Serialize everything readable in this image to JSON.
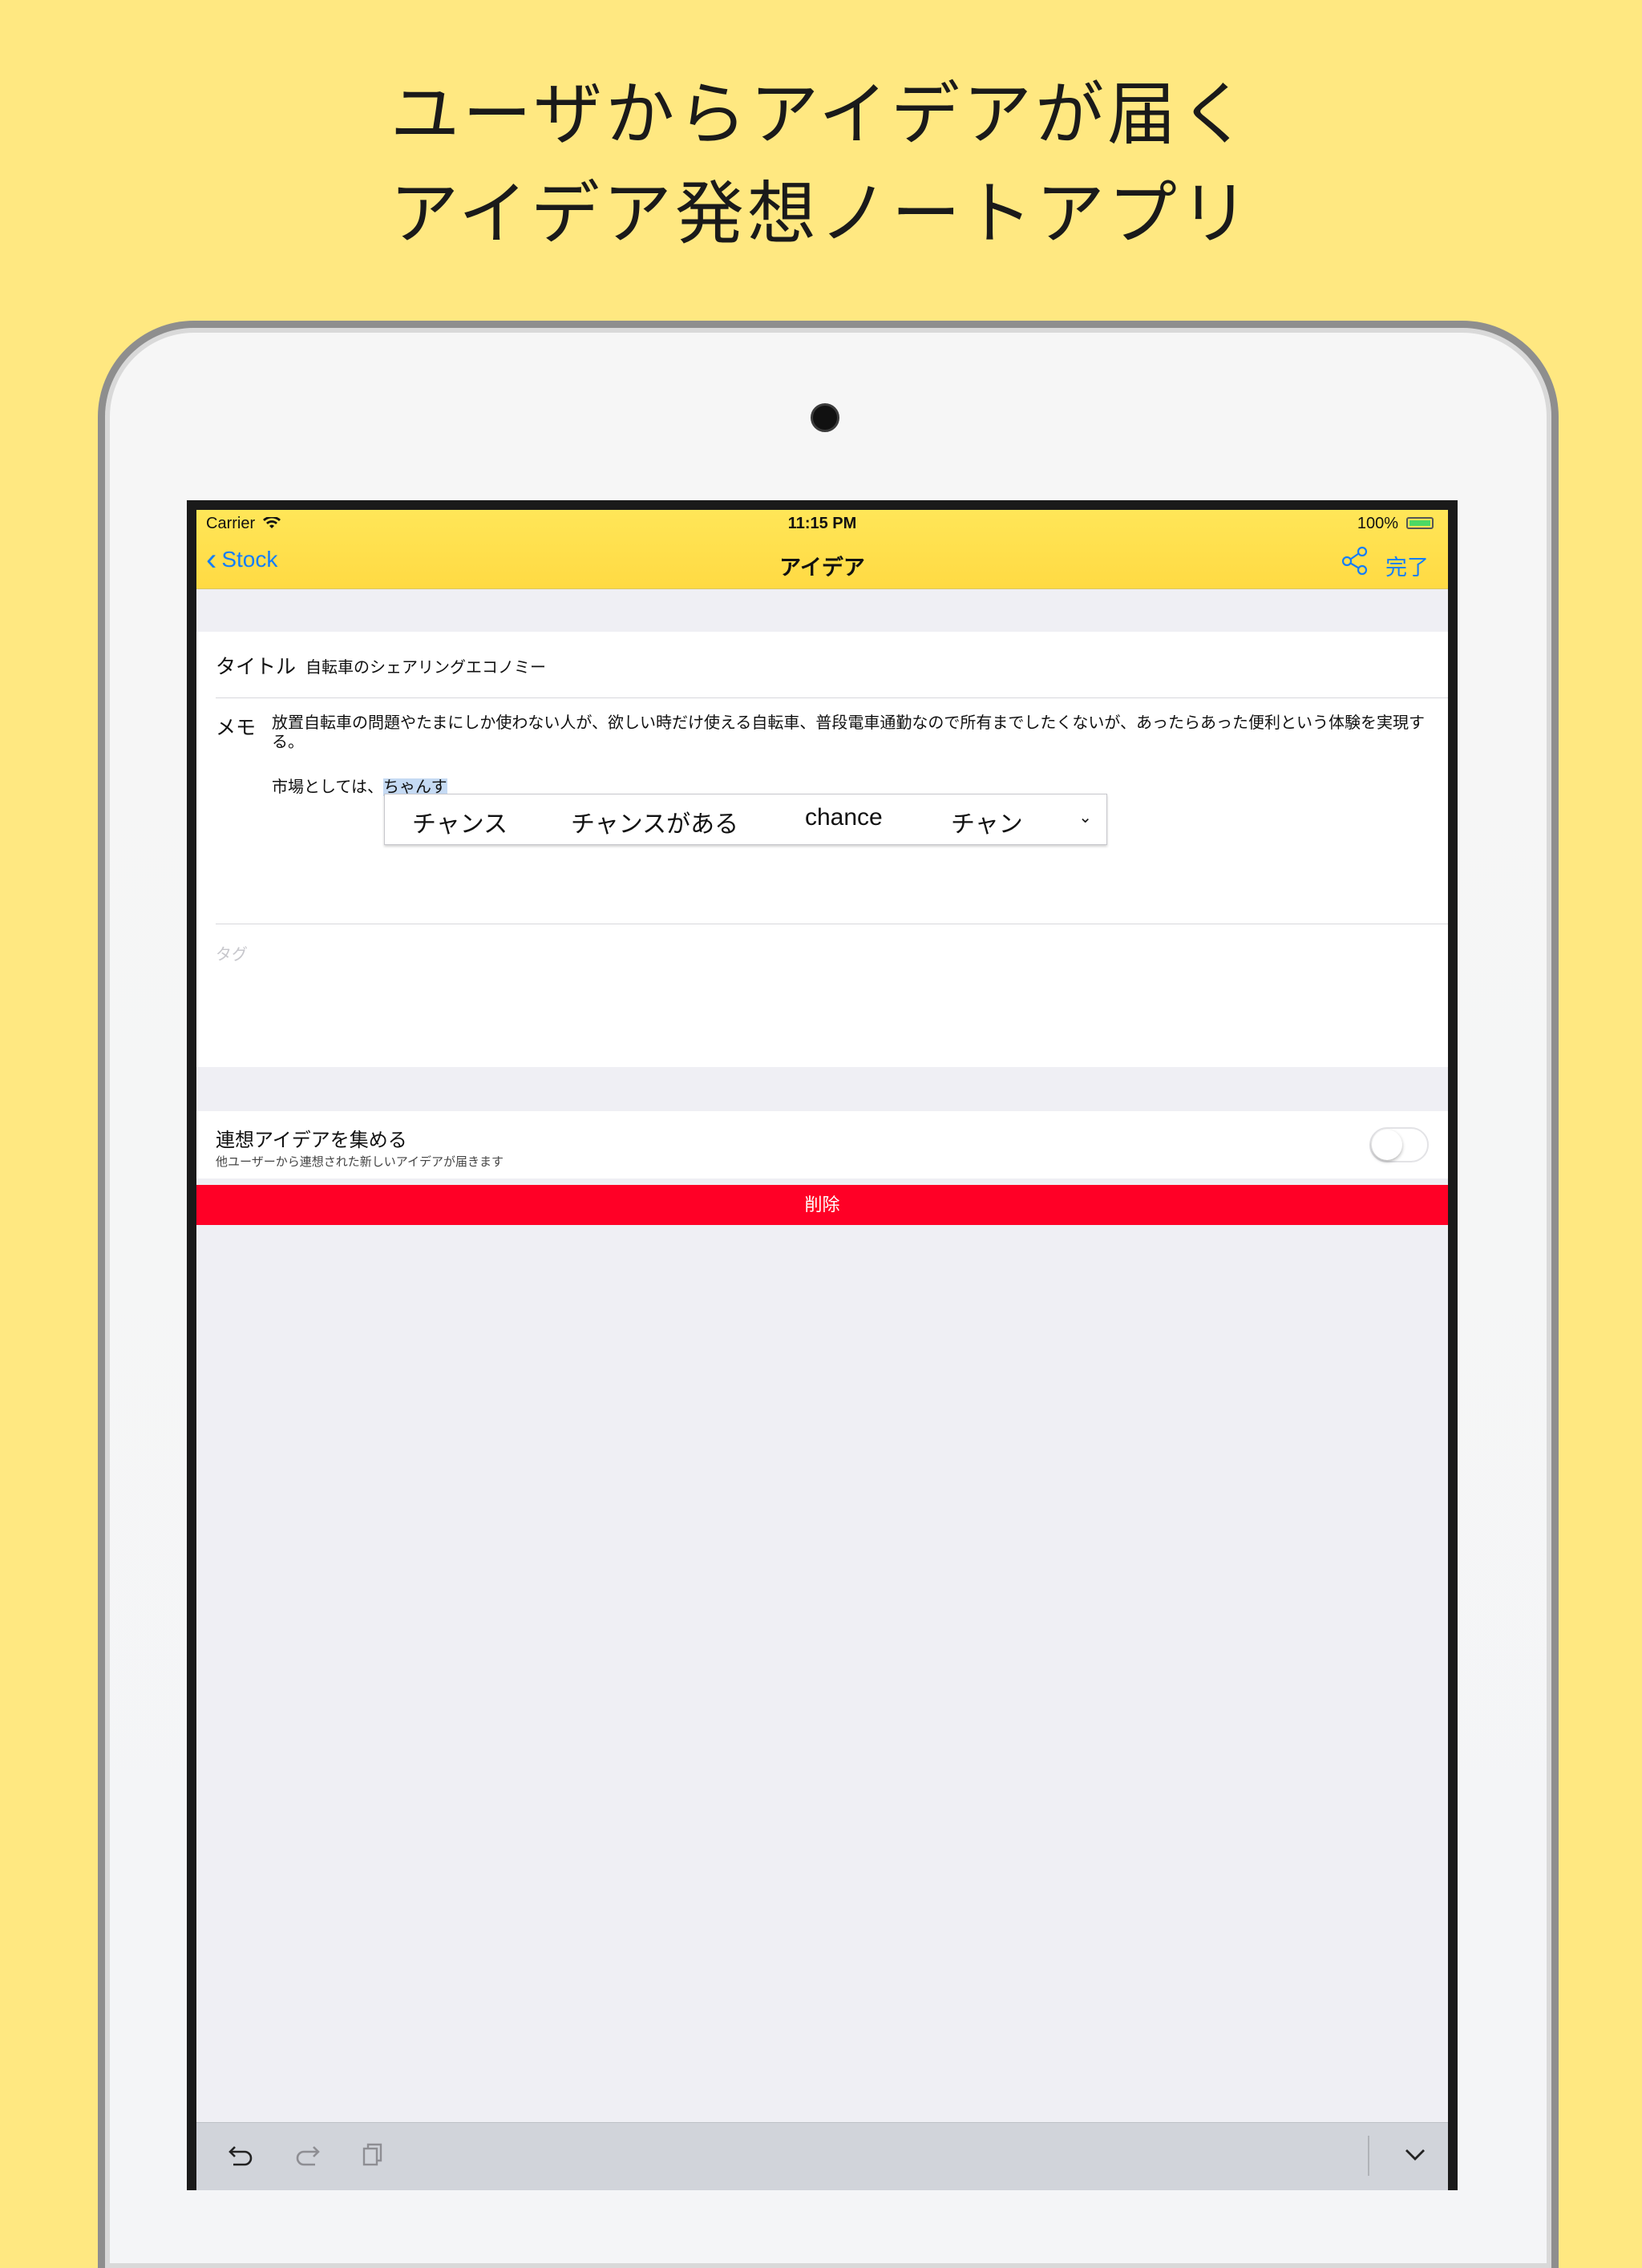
{
  "headline": {
    "line1": "ユーザからアイデアが届く",
    "line2": "アイデア発想ノートアプリ"
  },
  "status_bar": {
    "carrier": "Carrier",
    "time": "11:15 PM",
    "battery": "100%"
  },
  "nav": {
    "back_label": "Stock",
    "title": "アイデア",
    "done_label": "完了",
    "icons": [
      "chevron-left-icon",
      "share-icon"
    ]
  },
  "form": {
    "title_label": "タイトル",
    "title_value": "自転車のシェアリングエコノミー",
    "memo_label": "メモ",
    "memo_text": "放置自転車の問題やたまにしか使わない人が、欲しい時だけ使える自転車、普段電車通勤なので所有までしたくないが、あったらあった便利という体験を実現する。",
    "memo_line2_prefix": "市場としては、",
    "memo_line2_marked": "ちゃんす",
    "tag_placeholder": "タグ"
  },
  "ime_candidates": {
    "items": [
      "チャンス",
      "チャンスがある",
      "chance",
      "チャン"
    ],
    "more": "⌄"
  },
  "collect": {
    "title": "連想アイデアを集める",
    "subtitle": "他ユーザーから連想された新しいアイデアが届きます",
    "enabled": false
  },
  "delete_label": "削除",
  "keyboard_bar": {
    "icons": [
      "undo-icon",
      "redo-icon",
      "paste-icon",
      "dismiss-keyboard-icon"
    ]
  },
  "colors": {
    "background": "#FFE881",
    "nav_bar": "#FFDA43",
    "tint": "#147EFB",
    "delete": "#FF0026"
  }
}
